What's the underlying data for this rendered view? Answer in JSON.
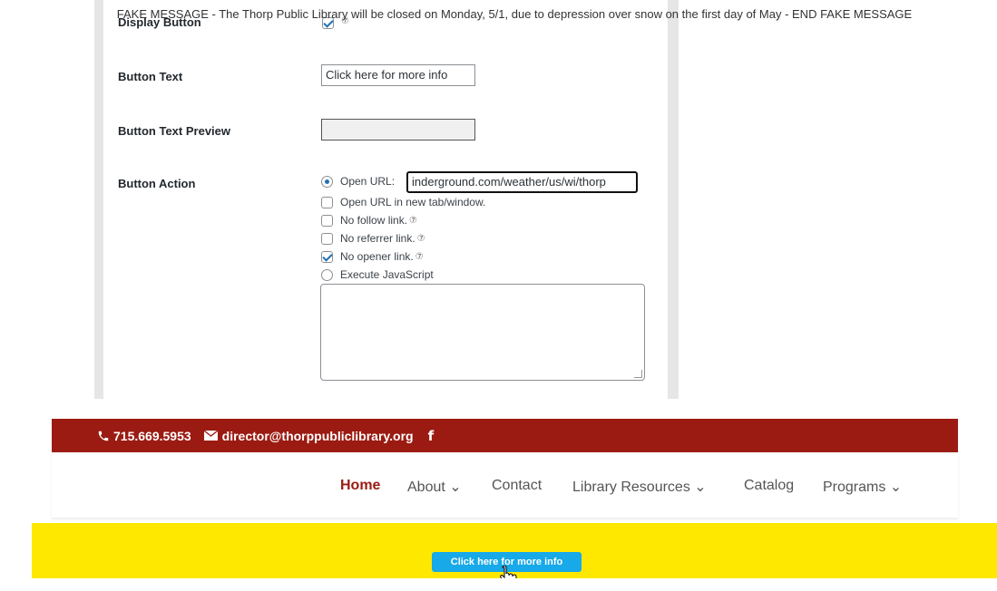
{
  "settings": {
    "display_button": {
      "label": "Display Button",
      "checked": true,
      "help": "⑦"
    },
    "button_text": {
      "label": "Button Text",
      "value": "Click here for more info"
    },
    "button_text_preview": {
      "label": "Button Text Preview",
      "value": ""
    },
    "button_action": {
      "label": "Button Action",
      "open_url": {
        "label": "Open URL:",
        "value": "inderground.com/weather/us/wi/thorp",
        "selected": true
      },
      "new_tab": {
        "label": "Open URL in new tab/window.",
        "checked": false
      },
      "no_follow": {
        "label": "No follow link.",
        "checked": false
      },
      "no_referrer": {
        "label": "No referrer link.",
        "checked": false
      },
      "no_opener": {
        "label": "No opener link.",
        "checked": true
      },
      "execute_js": {
        "label": "Execute JavaScript",
        "selected": false
      },
      "help": "⑦"
    }
  },
  "site": {
    "phone": "715.669.5953",
    "email": "director@thorppubliclibrary.org",
    "facebook": "f",
    "nav": [
      {
        "label": "Home",
        "active": true
      },
      {
        "label": "About ⌄"
      },
      {
        "label": "Contact"
      },
      {
        "label": "Library Resources ⌄"
      },
      {
        "label": "Catalog"
      },
      {
        "label": "Programs ⌄"
      }
    ],
    "banner": {
      "message": "FAKE MESSAGE - The Thorp Public Library will be closed on Monday, 5/1, due to depression over snow on the first day of May - END FAKE MESSAGE",
      "button": "Click here for more info"
    }
  },
  "colors": {
    "topbar": "#9b1b12",
    "banner": "#ffe800",
    "button": "#17a9e8",
    "active_nav": "#9b1b12"
  }
}
